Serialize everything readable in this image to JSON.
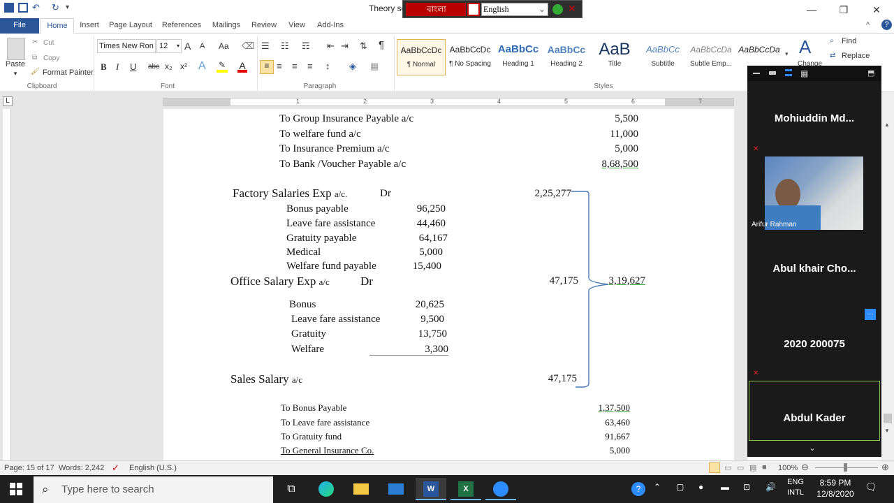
{
  "window": {
    "title": "Theory se",
    "minimize": "—",
    "restore": "❐",
    "close": "✕"
  },
  "langbar": {
    "bangla_label": "বাংলা",
    "language": "English"
  },
  "tabs": [
    "File",
    "Home",
    "Insert",
    "Page Layout",
    "References",
    "Mailings",
    "Review",
    "View",
    "Add-Ins"
  ],
  "ribbon": {
    "clipboard": {
      "paste": "Paste",
      "cut": "Cut",
      "copy": "Copy",
      "format_painter": "Format Painter",
      "label": "Clipboard"
    },
    "font": {
      "family": "Times New Ron",
      "size": "12",
      "grow": "A",
      "shrink": "A",
      "change_case": "Aa",
      "bold": "B",
      "italic": "I",
      "underline": "U",
      "strike": "abc",
      "subscript": "x₂",
      "superscript": "x²",
      "label": "Font"
    },
    "paragraph": {
      "show_marks": "¶",
      "label": "Paragraph"
    },
    "styles": {
      "items": [
        {
          "preview": "AaBbCcDc",
          "name": "¶ Normal"
        },
        {
          "preview": "AaBbCcDc",
          "name": "¶ No Spacing"
        },
        {
          "preview": "AaBbCc",
          "name": "Heading 1"
        },
        {
          "preview": "AaBbCc",
          "name": "Heading 2"
        },
        {
          "preview": "AaB",
          "name": "Title"
        },
        {
          "preview": "AaBbCc",
          "name": "Subtitle"
        },
        {
          "preview": "AaBbCcDa",
          "name": "Subtle Emp..."
        },
        {
          "preview": "AaBbCcDa",
          "name": ""
        }
      ],
      "change_styles": "Change",
      "label": "Styles"
    },
    "editing": {
      "find": "Find",
      "replace": "Replace"
    }
  },
  "ruler": {
    "numbers": [
      "1",
      "2",
      "3",
      "4",
      "5",
      "6",
      "7"
    ]
  },
  "document": {
    "top_lines": [
      {
        "text": "To Group Insurance Payable a/c",
        "amount": "5,500"
      },
      {
        "text": "To welfare fund a/c",
        "amount": "11,000"
      },
      {
        "text": "To Insurance Premium a/c",
        "amount": "5,000"
      },
      {
        "text": "To Bank /Voucher Payable a/c",
        "amount": "8,68,500"
      }
    ],
    "factory": {
      "title": "Factory Salaries Exp",
      "suffix": "a/c.",
      "dr": "Dr",
      "total": "2,25,277",
      "items": [
        {
          "label": "Bonus payable",
          "amount": "96,250"
        },
        {
          "label": "Leave fare assistance",
          "amount": "44,460"
        },
        {
          "label": "Gratuity payable",
          "amount": "64,167"
        },
        {
          "label": "Medical",
          "amount": "5,000"
        },
        {
          "label": "Welfare  fund payable",
          "amount": "15,400"
        }
      ]
    },
    "office": {
      "title": "Office Salary Exp",
      "suffix": "a/c",
      "dr": "Dr",
      "total": "47,175",
      "grand_total": "3,19,627",
      "items": [
        {
          "label": "Bonus",
          "amount": "20,625"
        },
        {
          "label": "Leave fare assistance",
          "amount": "9,500"
        },
        {
          "label": "Gratuity",
          "amount": "13,750"
        },
        {
          "label": "Welfare",
          "amount": "3,300"
        }
      ]
    },
    "sales": {
      "title": "Sales Salary",
      "suffix": "a/c",
      "total": "47,175"
    },
    "bottom_lines": [
      {
        "text": "To Bonus Payable",
        "amount": "1,37,500"
      },
      {
        "text": "To Leave fare assistance",
        "amount": "63,460"
      },
      {
        "text": "To Gratuity fund",
        "amount": "91,667"
      },
      {
        "text": "To General Insurance Co.",
        "amount": "5,000"
      }
    ]
  },
  "zoom_panel": {
    "participants": [
      {
        "name": "Mohiuddin  Md...",
        "muted": true
      },
      {
        "name": "Arifur Rahman",
        "video": true
      },
      {
        "name": "Abul khair  Cho...",
        "muted": false
      },
      {
        "name": "2020 200075",
        "muted": true
      },
      {
        "name": "Abdul Kader",
        "muted": false
      }
    ],
    "more": "···"
  },
  "status": {
    "page": "Page: 15 of 17",
    "words": "Words: 2,242",
    "language": "English (U.S.)",
    "zoom": "100%"
  },
  "taskbar": {
    "search_placeholder": "Type here to search",
    "lang_top": "ENG",
    "lang_bottom": "INTL",
    "time": "8:59 PM",
    "date": "12/8/2020"
  }
}
